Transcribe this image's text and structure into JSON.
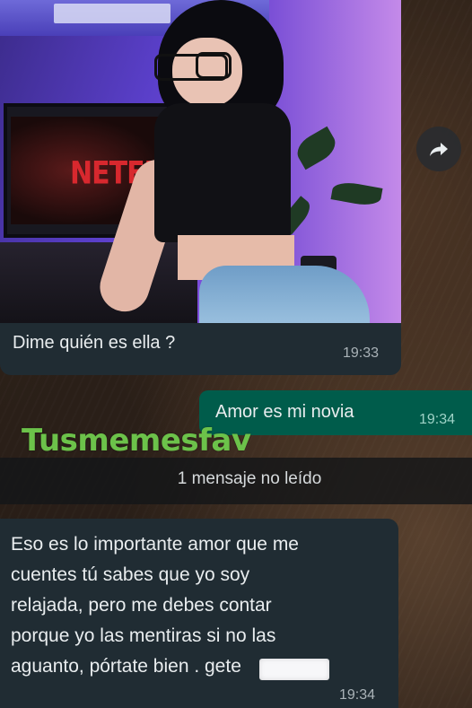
{
  "messages": {
    "incoming_image": {
      "caption": "Dime quién es ella ?",
      "time": "19:33",
      "photo_tv_logo": "NETFL"
    },
    "outgoing": {
      "text": "Amor es mi novia",
      "time": "19:34"
    },
    "unread_divider": "1 mensaje no leído",
    "incoming_text": {
      "text": "Eso es lo importante amor que me\ncuentes tú sabes que yo soy\nrelajada, pero me debes contar\nporque yo las mentiras si no las\naguanto, pórtate bien .           gete",
      "time": "19:34"
    }
  },
  "watermark": "Tusmemesfav",
  "icons": {
    "forward": "forward-arrow-icon"
  },
  "colors": {
    "incoming_bubble": "#202c33",
    "outgoing_bubble": "#005c4b",
    "watermark": "#6cc24a"
  }
}
